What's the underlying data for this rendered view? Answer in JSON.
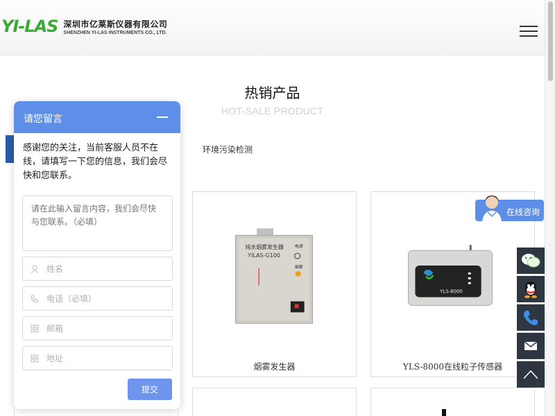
{
  "header": {
    "logo_mark": "YI-LAS",
    "company_cn": "深圳市亿莱斯仪器有限公司",
    "company_en": "SHENZHEN YI-LAS INSTRUMENTS CO., LTD.",
    "menu_icon": "hamburger-menu-icon"
  },
  "section": {
    "title": "热销产品",
    "subtitle": "HOT-SALE PRODUCT",
    "category_tab": "环境污染检测"
  },
  "products": [
    {
      "name": "烟雾发生器",
      "label_line1": "纯水烟雾发生器",
      "label_line2": "YILAS-G100",
      "label_power": "电源",
      "label_smoke": "烟雾"
    },
    {
      "name": "YLS-8000在线粒子传感器",
      "device_label": "YLS-8000"
    }
  ],
  "consult": {
    "label": "在线咨询"
  },
  "side_toolbar": [
    "wechat-icon",
    "qq-icon",
    "phone-icon",
    "mail-icon",
    "back-to-top-icon"
  ],
  "chat": {
    "title": "请您留言",
    "message": "感谢您的关注，当前客服人员不在线，请填写一下您的信息，我们会尽快和您联系。",
    "textarea_placeholder": "请在此输入留言内容，我们会尽快与您联系。（必填）",
    "name_placeholder": "姓名",
    "phone_placeholder": "电话（必填）",
    "email_placeholder": "邮箱",
    "address_placeholder": "地址",
    "submit_label": "提交"
  },
  "colors": {
    "brand_green": "#3aa935",
    "chat_blue": "#5e8fe8",
    "toolbar_dark": "#2e3641",
    "tab_blue": "#2a5ca8"
  }
}
